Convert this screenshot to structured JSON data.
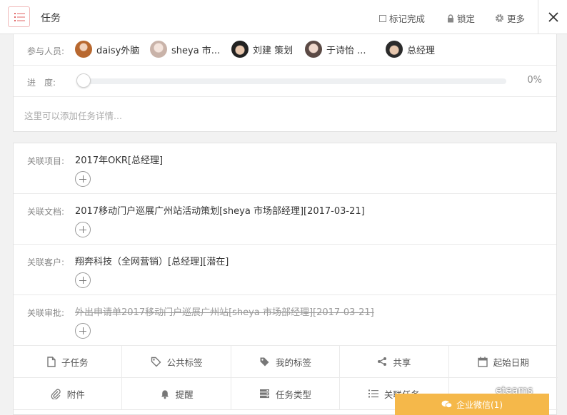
{
  "header": {
    "title": "任务",
    "mark_done": "标记完成",
    "lock": "锁定",
    "more": "更多"
  },
  "members": {
    "label": "参与人员:",
    "items": [
      {
        "name": "daisy外脑"
      },
      {
        "name": "sheya 市..."
      },
      {
        "name": "刘建 策划"
      },
      {
        "name": "于诗怡 ..."
      },
      {
        "name": "总经理"
      }
    ]
  },
  "progress": {
    "label": "进　度:",
    "value_percent": 0,
    "text": "0%"
  },
  "description": {
    "placeholder": "这里可以添加任务详情..."
  },
  "relations": [
    {
      "label": "关联项目:",
      "value": "2017年OKR[总经理]",
      "strike": false
    },
    {
      "label": "关联文档:",
      "value": "2017移动门户巡展广州站活动策划[sheya 市场部经理][2017-03-21]",
      "strike": false
    },
    {
      "label": "关联客户:",
      "value": "翔奔科技（全网营销）[总经理][潜在]",
      "strike": false
    },
    {
      "label": "关联审批:",
      "value": "外出申请单2017移动门户巡展广州站[sheya 市场部经理][2017-03-21]",
      "strike": true
    }
  ],
  "actions": [
    {
      "label": "子任务",
      "icon": "file-icon"
    },
    {
      "label": "公共标签",
      "icon": "tag-outline-icon"
    },
    {
      "label": "我的标签",
      "icon": "tag-icon"
    },
    {
      "label": "共享",
      "icon": "share-icon"
    },
    {
      "label": "起始日期",
      "icon": "calendar-icon"
    },
    {
      "label": "附件",
      "icon": "paperclip-icon"
    },
    {
      "label": "提醒",
      "icon": "bell-icon"
    },
    {
      "label": "任务类型",
      "icon": "server-icon"
    },
    {
      "label": "关联任务",
      "icon": "list-icon"
    }
  ],
  "overlay": {
    "wechat_label": "企业微信(1)",
    "watermark": "eteams"
  },
  "colors": {
    "accent_red": "#e06666",
    "progress_fill": "#6aa8e0",
    "wechat_bar": "#f5b84a"
  }
}
